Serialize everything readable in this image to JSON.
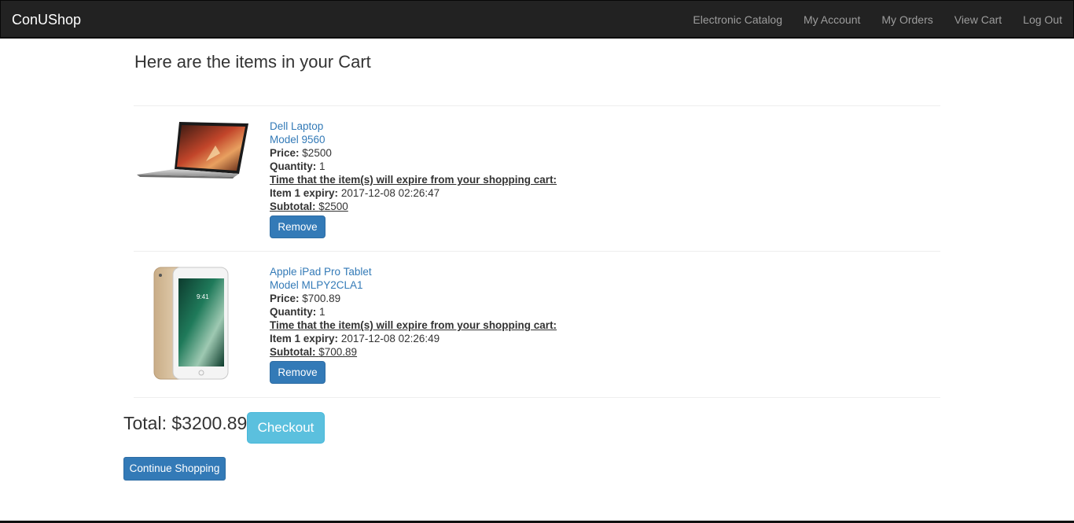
{
  "navbar": {
    "brand": "ConUShop",
    "links": [
      "Electronic Catalog",
      "My Account",
      "My Orders",
      "View Cart",
      "Log Out"
    ]
  },
  "heading": "Here are the items in your Cart",
  "items": [
    {
      "name": "Dell Laptop",
      "model": "Model 9560",
      "price_label": "Price:",
      "price": "$2500",
      "quantity_label": "Quantity:",
      "quantity": "1",
      "expire_note": "Time that the item(s) will expire from your shopping cart:",
      "expiry_label": "Item 1 expiry:",
      "expiry": "2017-12-08 02:26:47",
      "subtotal_label": "Subtotal:",
      "subtotal": "$2500",
      "remove_label": "Remove",
      "image": "laptop-image"
    },
    {
      "name": "Apple iPad Pro Tablet",
      "model": "Model MLPY2CLA1",
      "price_label": "Price:",
      "price": "$700.89",
      "quantity_label": "Quantity:",
      "quantity": "1",
      "expire_note": "Time that the item(s) will expire from your shopping cart:",
      "expiry_label": "Item 1 expiry:",
      "expiry": "2017-12-08 02:26:49",
      "subtotal_label": "Subtotal:",
      "subtotal": "$700.89",
      "remove_label": "Remove",
      "image": "tablet-image"
    }
  ],
  "total": "Total: $3200.89",
  "checkout_label": "Checkout",
  "continue_label": "Continue Shopping",
  "colors": {
    "navbar_bg": "#222222",
    "link": "#337ab7",
    "primary_button": "#337ab7",
    "info_button": "#5bc0de"
  }
}
